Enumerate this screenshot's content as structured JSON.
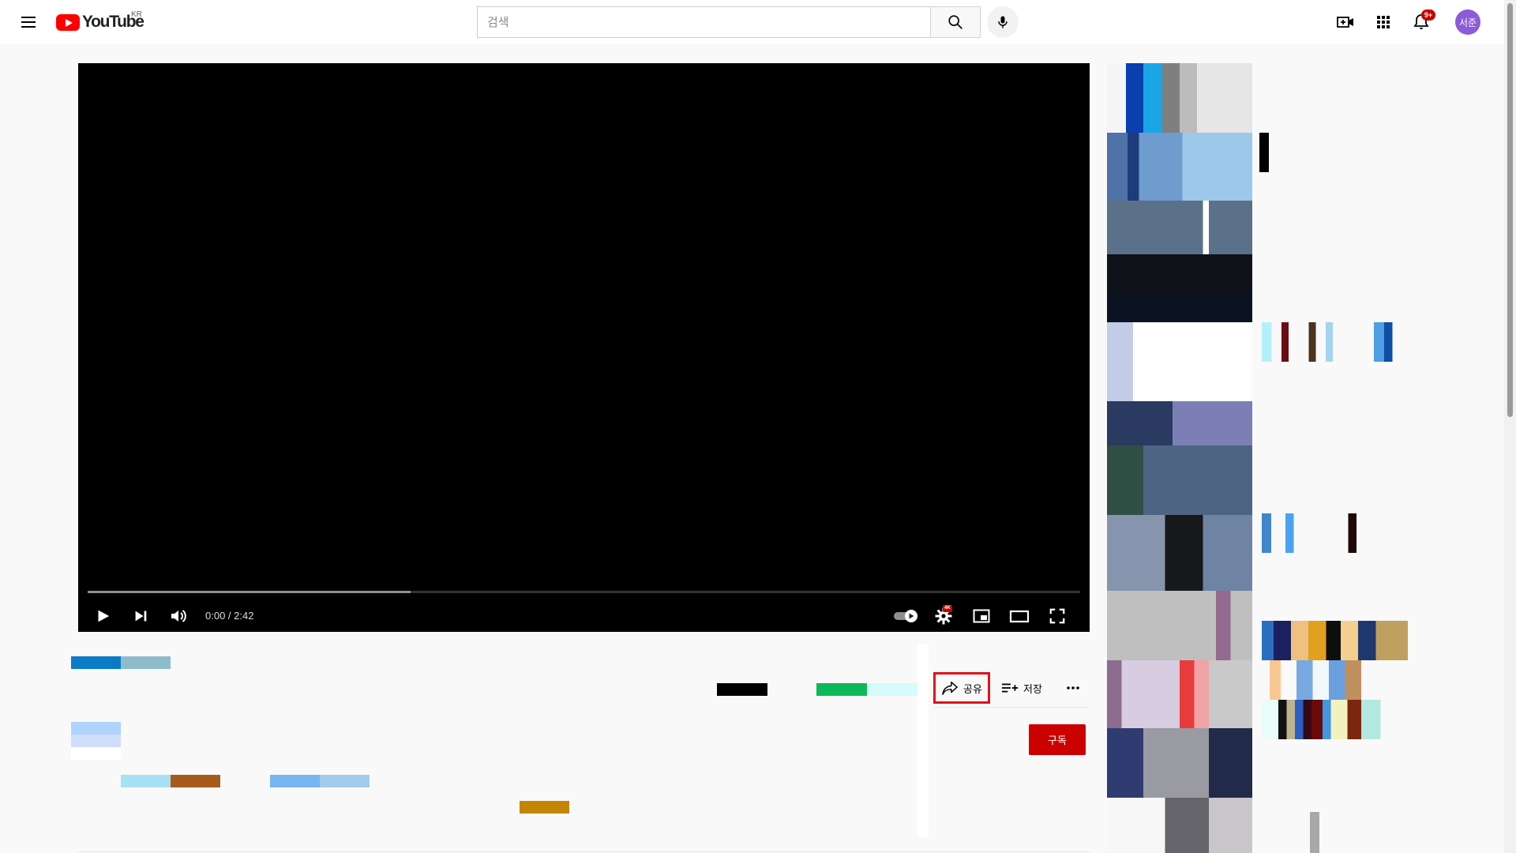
{
  "header": {
    "logo_text": "YouTube",
    "region_code": "KR",
    "search_placeholder": "검색",
    "notification_count": "9+",
    "avatar_label": "서준"
  },
  "player": {
    "time_display": "0:00 / 2:42",
    "quality_badge": "4K",
    "buffered_fraction": 0.325,
    "autoplay_on": true
  },
  "actions": {
    "share_label": "공유",
    "save_label": "저장",
    "subscribe_label": "구독"
  },
  "colors": {
    "brand_red": "#ff0000",
    "subscribe_red": "#cc0000",
    "highlight_border": "#e0111c",
    "avatar_purple": "#8c5bd9"
  },
  "icons": [
    "menu-icon",
    "youtube-logo-icon",
    "search-icon",
    "mic-icon",
    "create-video-icon",
    "apps-grid-icon",
    "bell-icon",
    "play-icon",
    "next-icon",
    "volume-icon",
    "autoplay-toggle-icon",
    "settings-icon",
    "miniplayer-icon",
    "theater-icon",
    "fullscreen-icon",
    "share-icon",
    "playlist-add-icon",
    "more-horizontal-icon"
  ]
}
